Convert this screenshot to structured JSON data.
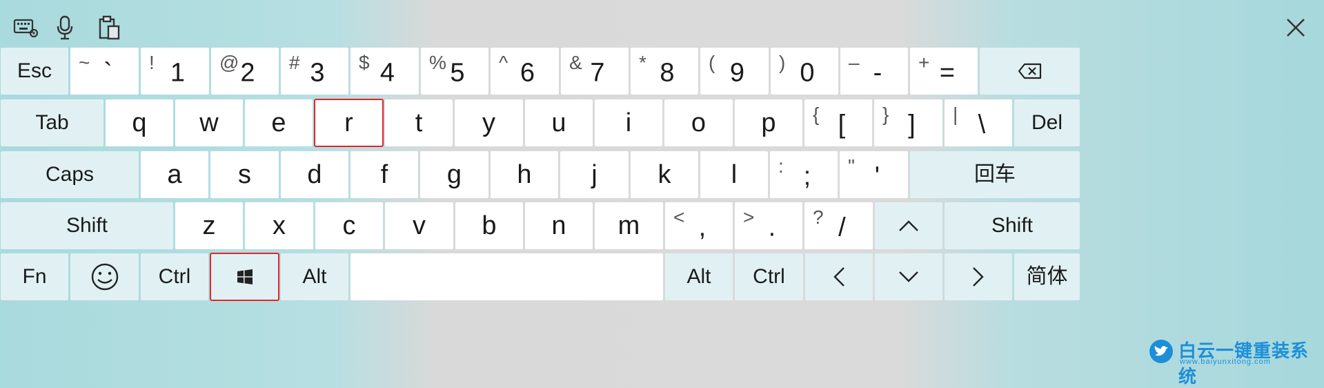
{
  "toolbar": {
    "icons": [
      "keyboard-settings-icon",
      "microphone-icon",
      "clipboard-icon"
    ],
    "close_icon": "close-icon"
  },
  "rows": [
    {
      "name": "number-row",
      "keys": [
        {
          "label": "Esc",
          "id": "esc",
          "type": "fn"
        },
        {
          "label": "`",
          "shift": "~",
          "id": "backtick",
          "type": "sym"
        },
        {
          "label": "1",
          "shift": "!",
          "id": "1",
          "type": "num"
        },
        {
          "label": "2",
          "shift": "@",
          "id": "2",
          "type": "num"
        },
        {
          "label": "3",
          "shift": "#",
          "id": "3",
          "type": "num"
        },
        {
          "label": "4",
          "shift": "$",
          "id": "4",
          "type": "num"
        },
        {
          "label": "5",
          "shift": "%",
          "id": "5",
          "type": "num"
        },
        {
          "label": "6",
          "shift": "^",
          "id": "6",
          "type": "num"
        },
        {
          "label": "7",
          "shift": "&",
          "id": "7",
          "type": "num"
        },
        {
          "label": "8",
          "shift": "*",
          "id": "8",
          "type": "num"
        },
        {
          "label": "9",
          "shift": "(",
          "id": "9",
          "type": "num"
        },
        {
          "label": "0",
          "shift": ")",
          "id": "0",
          "type": "num"
        },
        {
          "label": "-",
          "shift": "–",
          "id": "minus",
          "type": "sym"
        },
        {
          "label": "=",
          "shift": "+",
          "id": "equals",
          "type": "sym"
        },
        {
          "label": "",
          "icon": "backspace-icon",
          "id": "backspace",
          "type": "fn"
        }
      ]
    },
    {
      "name": "qwerty-row",
      "keys": [
        {
          "label": "Tab",
          "id": "tab",
          "type": "fn"
        },
        {
          "label": "q",
          "id": "q"
        },
        {
          "label": "w",
          "id": "w"
        },
        {
          "label": "e",
          "id": "e"
        },
        {
          "label": "r",
          "id": "r",
          "highlight": true
        },
        {
          "label": "t",
          "id": "t"
        },
        {
          "label": "y",
          "id": "y"
        },
        {
          "label": "u",
          "id": "u"
        },
        {
          "label": "i",
          "id": "i"
        },
        {
          "label": "o",
          "id": "o"
        },
        {
          "label": "p",
          "id": "p"
        },
        {
          "label": "[",
          "shift": "{",
          "id": "lbracket",
          "type": "sym"
        },
        {
          "label": "]",
          "shift": "}",
          "id": "rbracket",
          "type": "sym"
        },
        {
          "label": "\\",
          "shift": "|",
          "id": "backslash",
          "type": "sym"
        },
        {
          "label": "Del",
          "id": "del",
          "type": "fn"
        }
      ]
    },
    {
      "name": "home-row",
      "keys": [
        {
          "label": "Caps",
          "id": "caps",
          "type": "fn"
        },
        {
          "label": "a",
          "id": "a"
        },
        {
          "label": "s",
          "id": "s"
        },
        {
          "label": "d",
          "id": "d"
        },
        {
          "label": "f",
          "id": "f"
        },
        {
          "label": "g",
          "id": "g"
        },
        {
          "label": "h",
          "id": "h"
        },
        {
          "label": "j",
          "id": "j"
        },
        {
          "label": "k",
          "id": "k"
        },
        {
          "label": "l",
          "id": "l"
        },
        {
          "label": ";",
          "shift": ":",
          "id": "semicolon",
          "type": "sym"
        },
        {
          "label": "'",
          "shift": "\"",
          "id": "quote",
          "type": "sym"
        },
        {
          "label": "回车",
          "id": "enter",
          "type": "fn"
        }
      ]
    },
    {
      "name": "shift-row",
      "keys": [
        {
          "label": "Shift",
          "id": "lshift",
          "type": "fn"
        },
        {
          "label": "z",
          "id": "z"
        },
        {
          "label": "x",
          "id": "x"
        },
        {
          "label": "c",
          "id": "c"
        },
        {
          "label": "v",
          "id": "v"
        },
        {
          "label": "b",
          "id": "b"
        },
        {
          "label": "n",
          "id": "n"
        },
        {
          "label": "m",
          "id": "m"
        },
        {
          "label": ",",
          "shift": "<",
          "id": "comma",
          "type": "sym"
        },
        {
          "label": ".",
          "shift": ">",
          "id": "period",
          "type": "sym"
        },
        {
          "label": "/",
          "shift": "?",
          "id": "slash",
          "type": "sym"
        },
        {
          "label": "",
          "icon": "arrow-up-icon",
          "id": "up",
          "type": "fn"
        },
        {
          "label": "Shift",
          "id": "rshift",
          "type": "fn"
        }
      ]
    },
    {
      "name": "bottom-row",
      "keys": [
        {
          "label": "Fn",
          "id": "fn",
          "type": "fn"
        },
        {
          "label": "",
          "icon": "emoji-icon",
          "id": "emoji",
          "type": "fn"
        },
        {
          "label": "Ctrl",
          "id": "lctrl",
          "type": "fn"
        },
        {
          "label": "",
          "icon": "windows-icon",
          "id": "win",
          "type": "fn",
          "highlight": true
        },
        {
          "label": "Alt",
          "id": "lalt",
          "type": "fn"
        },
        {
          "label": "",
          "id": "space"
        },
        {
          "label": "Alt",
          "id": "ralt",
          "type": "fn"
        },
        {
          "label": "Ctrl",
          "id": "rctrl",
          "type": "fn"
        },
        {
          "label": "",
          "icon": "arrow-left-icon",
          "id": "left",
          "type": "fn"
        },
        {
          "label": "",
          "icon": "arrow-down-icon",
          "id": "down",
          "type": "fn"
        },
        {
          "label": "",
          "icon": "arrow-right-icon",
          "id": "right",
          "type": "fn"
        },
        {
          "label": "简体",
          "id": "lang",
          "type": "fn"
        }
      ]
    }
  ],
  "watermark": {
    "text": "白云一键重装系统",
    "url": "www.baiyunxitong.com",
    "icon": "twitter-bird-icon"
  },
  "colors": {
    "highlight_border": "#e0262a",
    "key_bg": "#ffffff",
    "function_key_bg": "#e1f1f3",
    "watermark": "#1d8fd9"
  }
}
